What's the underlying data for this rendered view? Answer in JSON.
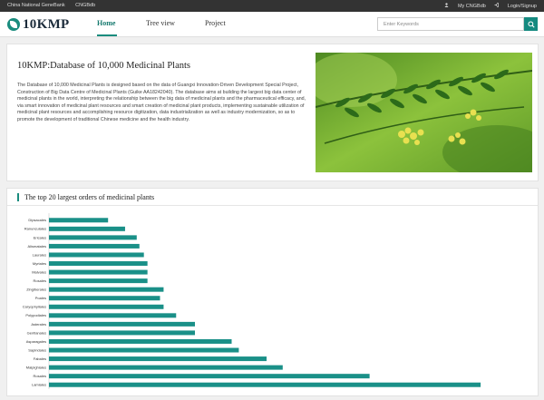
{
  "topbar": {
    "left": [
      "China National GeneBank",
      "CNGBdb"
    ],
    "right": [
      "My CNGBdb",
      "Login/Signup"
    ]
  },
  "brand": {
    "name": "10KMP"
  },
  "nav": {
    "items": [
      "Home",
      "Tree view",
      "Project"
    ]
  },
  "search": {
    "placeholder": "Enter Keywords"
  },
  "intro": {
    "title": "10KMP:Database of 10,000 Medicinal Plants",
    "body": "The Database of 10,000 Medicinal Plants is designed based on the data of Guangxi Innovation-Driven Development Special Project, Construction of Big Data Centre of Medicinal Plants (Guike AA18242040). The database aims at building the largest big data center of medicinal plants in the world, interpreting the relationship between the big data of medicinal plants and the pharmaceutical efficacy, and, via smart innovation of medicinal plant resources and smart creation of medicinal plant products, implementing sustainable utilization of medicinal plant resources and accomplishing resource digitization, data industrialization as well as industry modernization, so as to promote the development of traditional Chinese medicine and the health industry."
  },
  "chart_section": {
    "title": "The top 20 largest orders of medicinal plants"
  },
  "chart_data": {
    "type": "bar",
    "orientation": "horizontal",
    "title": "The top 20 largest orders of medicinal plants",
    "categories": [
      "Dipsacales",
      "Ranunculales",
      "Ericales",
      "Alismatales",
      "Laurales",
      "Myrtales",
      "Malvales",
      "Rosales",
      "Zingiberales",
      "Poales",
      "Caryophyllales",
      "Polypodiales",
      "Asterales",
      "Gentianales",
      "Asparagales",
      "Sapindales",
      "Fabales",
      "Malpighiales",
      "Rosales",
      "Lamiales"
    ],
    "values": [
      66,
      85,
      98,
      101,
      106,
      110,
      110,
      110,
      128,
      124,
      128,
      142,
      163,
      163,
      204,
      212,
      243,
      261,
      358,
      482
    ],
    "xlim": [
      0,
      490
    ],
    "grid": false,
    "legend": "none",
    "bar_color": "#1a9088"
  },
  "colors": {
    "accent": "#1a8c7e",
    "bar": "#1a9088",
    "topbar": "#333333"
  },
  "icons": {
    "search": "search-icon",
    "user": "user-icon",
    "login": "login-icon"
  }
}
